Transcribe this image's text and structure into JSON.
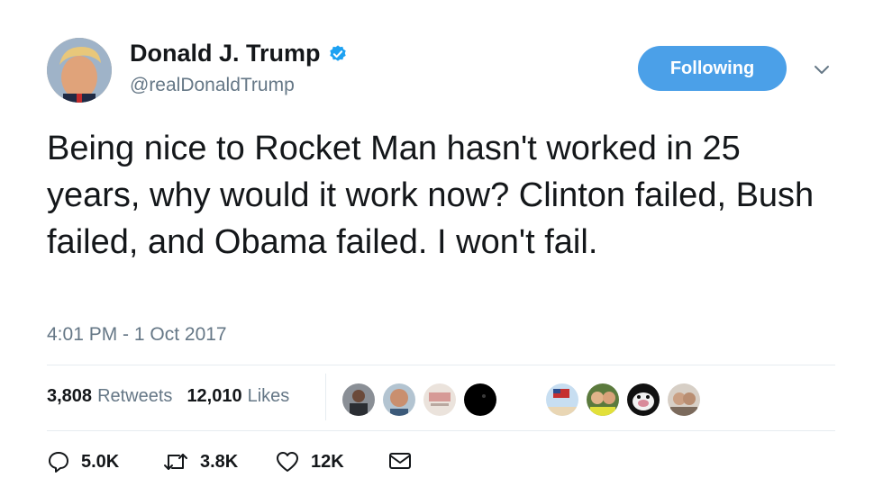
{
  "author": {
    "name": "Donald J. Trump",
    "handle": "@realDonaldTrump",
    "verified": true
  },
  "follow_button": {
    "label": "Following",
    "color": "#4ba0e8"
  },
  "tweet": {
    "text": "Being nice to Rocket Man hasn't worked in 25 years, why would it work now? Clinton failed, Bush failed, and Obama failed. I won't fail.",
    "timestamp": "4:01 PM - 1 Oct 2017"
  },
  "stats": {
    "retweets_count": "3,808",
    "retweets_label": "Retweets",
    "likes_count": "12,010",
    "likes_label": "Likes"
  },
  "actions": {
    "reply_count": "5.0K",
    "retweet_count": "3.8K",
    "like_count": "12K"
  },
  "likers": [
    {
      "icon": "liker-avatar-1"
    },
    {
      "icon": "liker-avatar-2"
    },
    {
      "icon": "liker-avatar-3"
    },
    {
      "icon": "liker-avatar-4"
    },
    {
      "icon": "liker-avatar-5"
    },
    {
      "icon": "liker-avatar-6"
    },
    {
      "icon": "liker-avatar-7"
    },
    {
      "icon": "liker-avatar-8"
    }
  ]
}
